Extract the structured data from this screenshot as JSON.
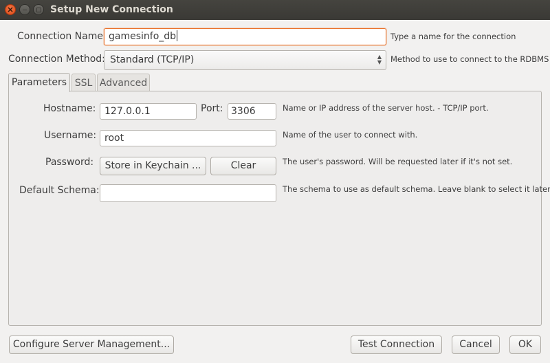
{
  "window": {
    "title": "Setup New Connection"
  },
  "connection": {
    "name_label": "Connection Name:",
    "name_value": "gamesinfo_db",
    "name_hint": "Type a name for the connection",
    "method_label": "Connection Method:",
    "method_value": "Standard (TCP/IP)",
    "method_hint": "Method to use to connect to the RDBMS"
  },
  "tabs": [
    {
      "label": "Parameters",
      "active": true
    },
    {
      "label": "SSL",
      "active": false
    },
    {
      "label": "Advanced",
      "active": false
    }
  ],
  "params": {
    "hostname_label": "Hostname:",
    "hostname_value": "127.0.0.1",
    "port_label": "Port:",
    "port_value": "3306",
    "hostname_hint": "Name or IP address of the server host. - TCP/IP port.",
    "username_label": "Username:",
    "username_value": "root",
    "username_hint": "Name of the user to connect with.",
    "password_label": "Password:",
    "store_keychain_label": "Store in Keychain ...",
    "clear_label": "Clear",
    "password_hint": "The user's password. Will be requested later if it's not set.",
    "schema_label": "Default Schema:",
    "schema_value": "",
    "schema_hint": "The schema to use as default schema. Leave blank to select it later"
  },
  "footer": {
    "configure_label": "Configure Server Management...",
    "test_label": "Test Connection",
    "cancel_label": "Cancel",
    "ok_label": "OK"
  },
  "colors": {
    "titlebar": "#3c3b37",
    "close_button": "#df4a16",
    "focus_border": "#e9732d",
    "dialog_bg": "#f2f1f0"
  },
  "icons": {
    "close": "close-icon",
    "minimize": "minimize-icon",
    "maximize": "maximize-icon",
    "select_arrows": "updown-arrows-icon"
  }
}
